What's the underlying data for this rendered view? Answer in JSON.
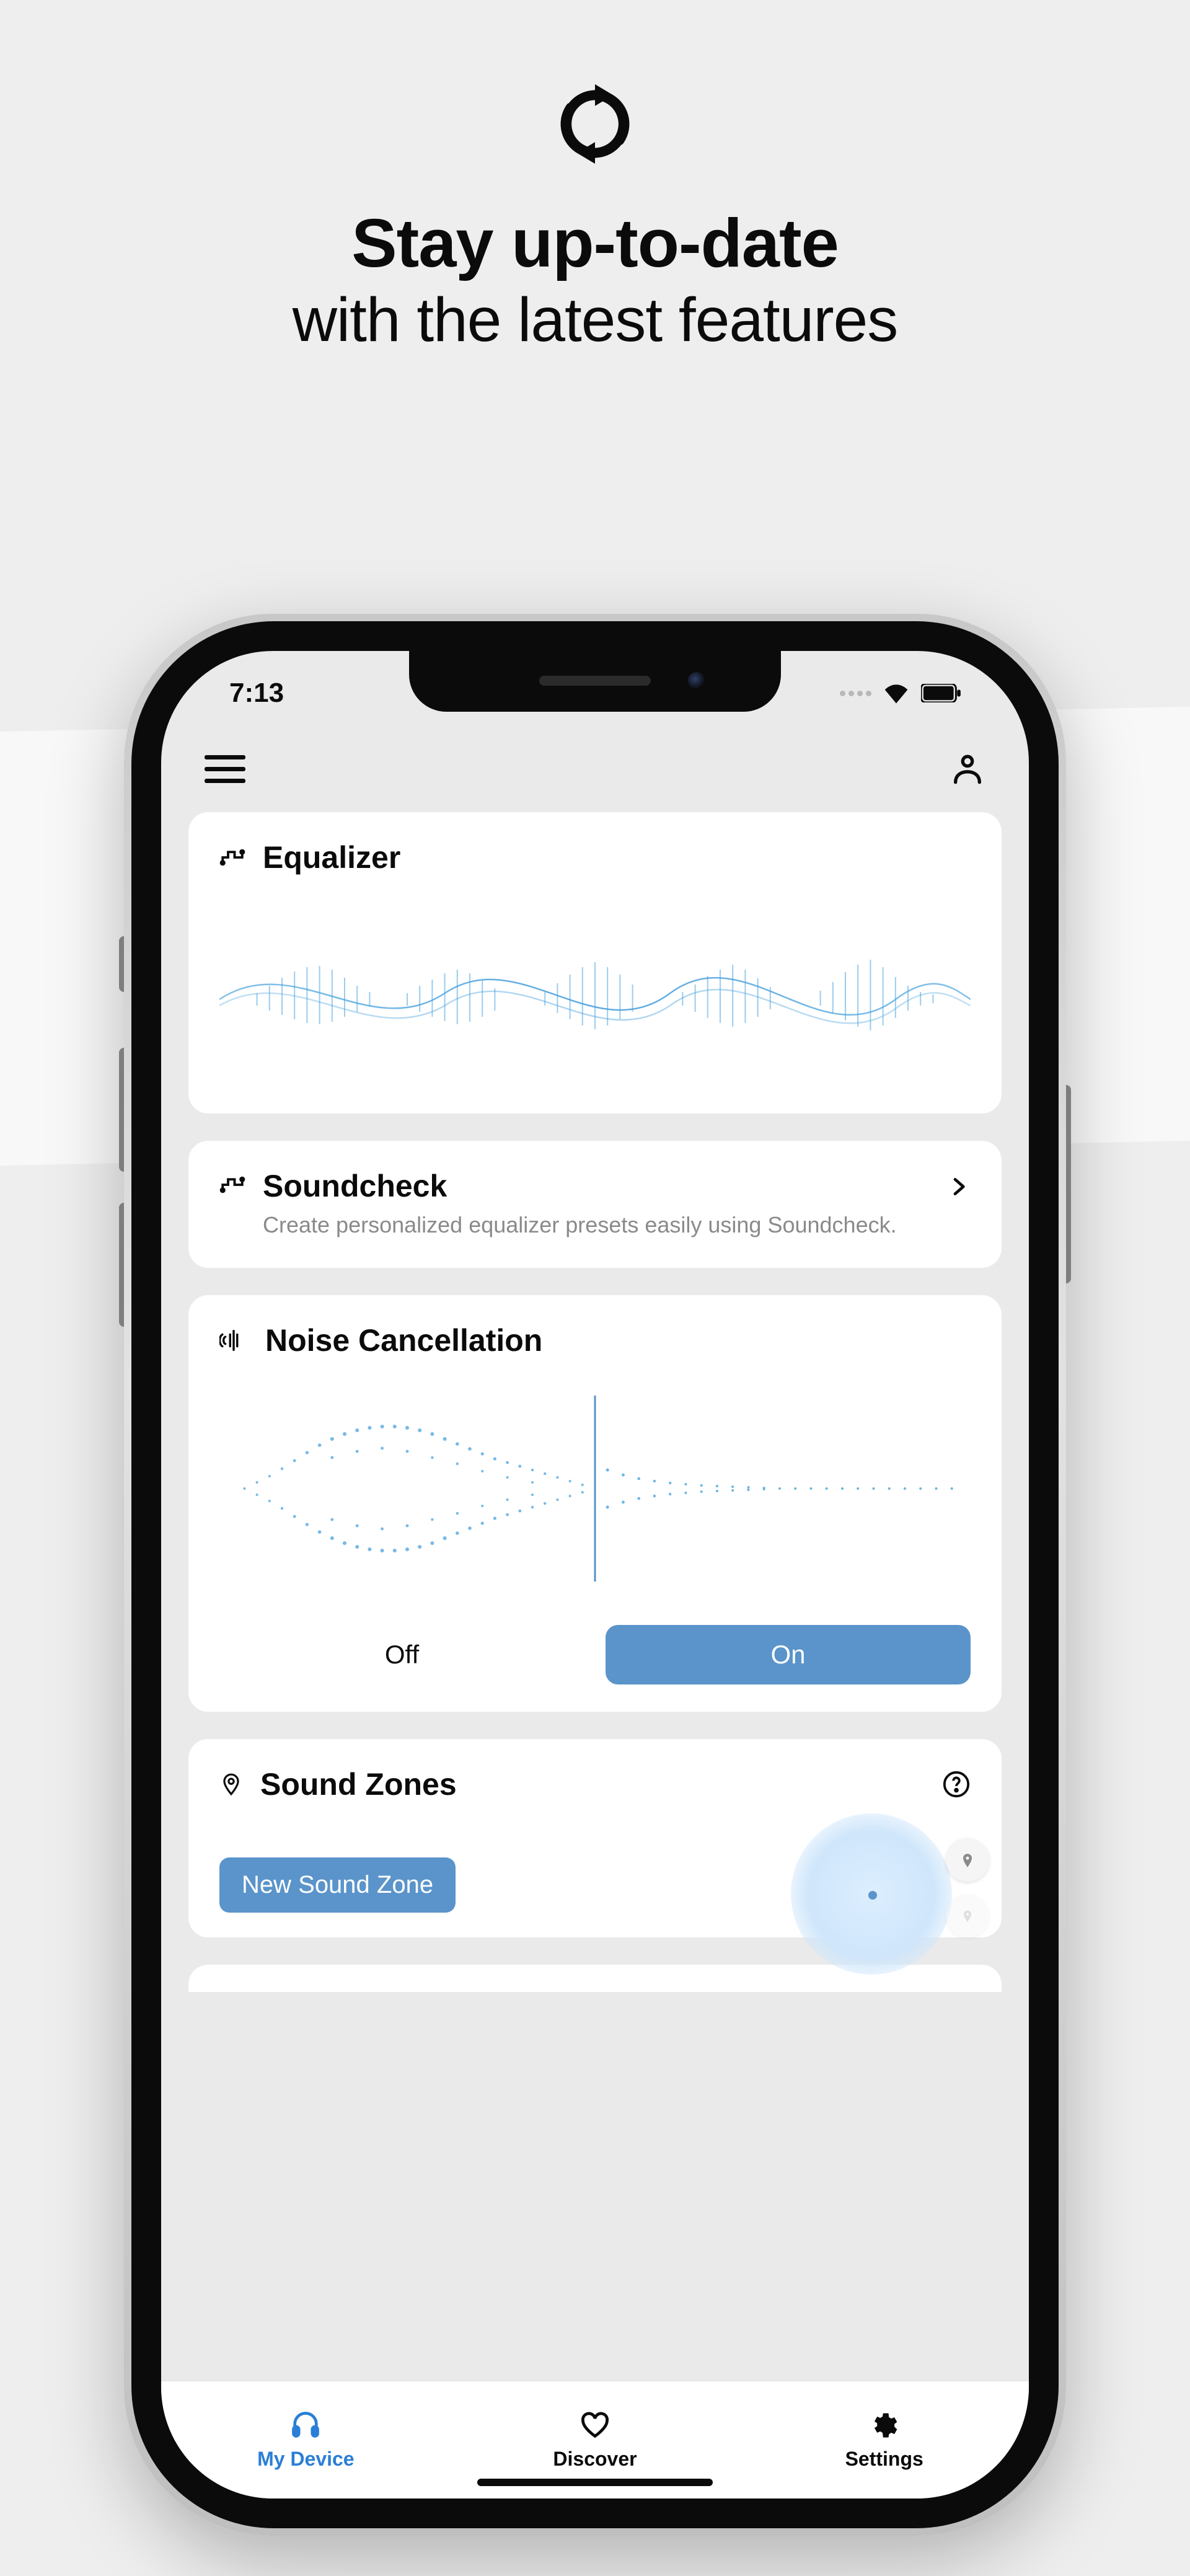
{
  "hero": {
    "title_bold": "Stay up-to-date",
    "title_sub": "with the latest features"
  },
  "statusbar": {
    "time": "7:13"
  },
  "cards": {
    "equalizer": {
      "title": "Equalizer"
    },
    "soundcheck": {
      "title": "Soundcheck",
      "subtitle": "Create personalized equalizer presets easily using Soundcheck."
    },
    "noise_cancellation": {
      "title": "Noise Cancellation",
      "off_label": "Off",
      "on_label": "On"
    },
    "sound_zones": {
      "title": "Sound Zones",
      "button_label": "New Sound Zone"
    }
  },
  "bottom_nav": {
    "my_device": "My Device",
    "discover": "Discover",
    "settings": "Settings"
  },
  "colors": {
    "accent": "#5a94ca",
    "primary_blue": "#2a7fd6"
  }
}
